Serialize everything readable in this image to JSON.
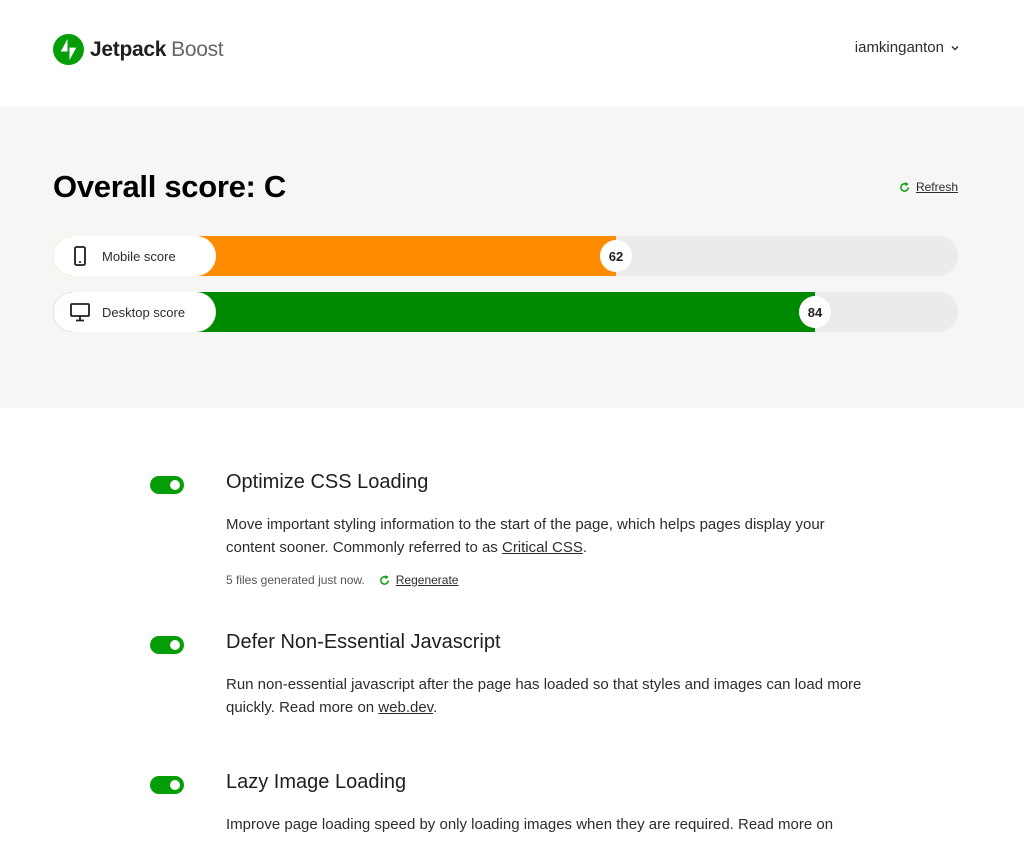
{
  "header": {
    "brand": "Jetpack",
    "product": "Boost",
    "username": "iamkinganton"
  },
  "colors": {
    "accent": "#069e08",
    "mobile_bar": "#ff8c00",
    "desktop_bar": "#008a00",
    "panel_bg": "#f6f6f4",
    "track": "#ebebeb"
  },
  "score": {
    "overall_label": "Overall score: C",
    "refresh_label": "Refresh",
    "mobile": {
      "label": "Mobile score",
      "value": 62,
      "icon": "mobile-phone-icon"
    },
    "desktop": {
      "label": "Desktop score",
      "value": 84,
      "icon": "desktop-monitor-icon"
    }
  },
  "features": [
    {
      "title": "Optimize CSS Loading",
      "enabled": true,
      "desc_before": "Move important styling information to the start of the page, which helps pages display your content sooner. Commonly referred to as ",
      "link": "Critical CSS",
      "desc_after": ".",
      "meta": "5 files generated just now.",
      "action": "Regenerate"
    },
    {
      "title": "Defer Non-Essential Javascript",
      "enabled": true,
      "desc_before": "Run non-essential javascript after the page has loaded so that styles and images can load more quickly. Read more on ",
      "link": "web.dev",
      "desc_after": "."
    },
    {
      "title": "Lazy Image Loading",
      "enabled": true,
      "desc_before": "Improve page loading speed by only loading images when they are required. Read more on ",
      "link": "",
      "desc_after": ""
    }
  ]
}
